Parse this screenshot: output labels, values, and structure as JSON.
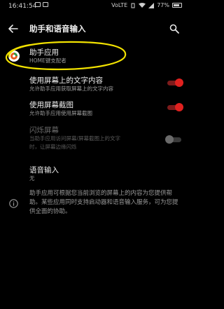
{
  "status_bar": {
    "time": "16:41:54",
    "battery_percent": "77%",
    "network_label": "VoLTE"
  },
  "toolbar": {
    "back_icon": "back-arrow-icon",
    "title": "助手和语音输入",
    "search_icon": "search-icon"
  },
  "assist_app": {
    "title": "助手应用",
    "subtitle": "HOME键支配者",
    "icon": "app-icon"
  },
  "settings": [
    {
      "title": "使用屏幕上的文字内容",
      "subtitle": "允许助手应用获取屏幕上的文字内容",
      "toggle": true,
      "enabled": true
    },
    {
      "title": "使用屏幕截图",
      "subtitle": "允许助手应用使用屏幕截图",
      "toggle": true,
      "enabled": true
    },
    {
      "title": "闪烁屏幕",
      "subtitle_lines": [
        "当助手应用访问屏幕/屏幕截图上的文字",
        "时，让屏幕边缘闪烁"
      ],
      "toggle": false,
      "enabled": false
    }
  ],
  "voice_input": {
    "title": "语音输入",
    "subtitle": "无"
  },
  "info": {
    "icon": "info-icon",
    "text": "助手应用可根据您当前浏览的屏幕上的内容为您提供帮助。某些应用同时支持启动器和语音输入服务，可为您提供全面的协助。"
  },
  "colors": {
    "accent": "#e0211f",
    "highlight_annotation": "#f2e200",
    "background": "#000000"
  }
}
